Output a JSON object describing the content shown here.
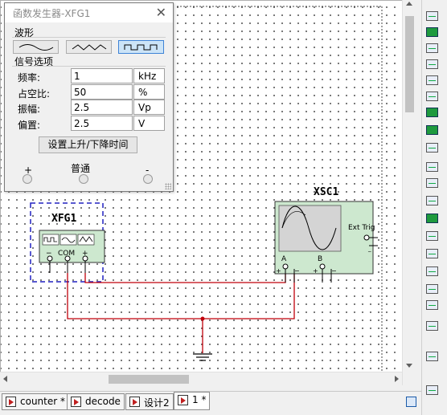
{
  "dialog": {
    "title": "函数发生器-XFG1",
    "close": "✕",
    "waveform_label": "波形",
    "waveforms": [
      "sine",
      "triangle",
      "square"
    ],
    "selected_waveform": "square",
    "signal_options_label": "信号选项",
    "fields": [
      {
        "label": "频率:",
        "value": "1",
        "unit": "kHz"
      },
      {
        "label": "占空比:",
        "value": "50",
        "unit": "%"
      },
      {
        "label": "振幅:",
        "value": "2.5",
        "unit": "Vp"
      },
      {
        "label": "偏置:",
        "value": "2.5",
        "unit": "V"
      }
    ],
    "rise_fall_button": "设置上升/下降时间",
    "terminal_plus": "+",
    "terminal_common": "普通",
    "terminal_minus": "-"
  },
  "schematic": {
    "fg_name": "XFG1",
    "fg_terminals": "COM",
    "fg_minus": "−",
    "fg_plus": "+",
    "scope_name": "XSC1",
    "scope_ext_trig": "Ext Trig",
    "scope_channel_a": "A",
    "scope_channel_b": "B",
    "wire_color": "#c0000a",
    "wire_blue": "#2020c0"
  },
  "tabs": [
    {
      "label": "counter *",
      "active": false
    },
    {
      "label": "decode",
      "active": false
    },
    {
      "label": "设计2",
      "active": false
    },
    {
      "label": "1 *",
      "active": true
    }
  ]
}
